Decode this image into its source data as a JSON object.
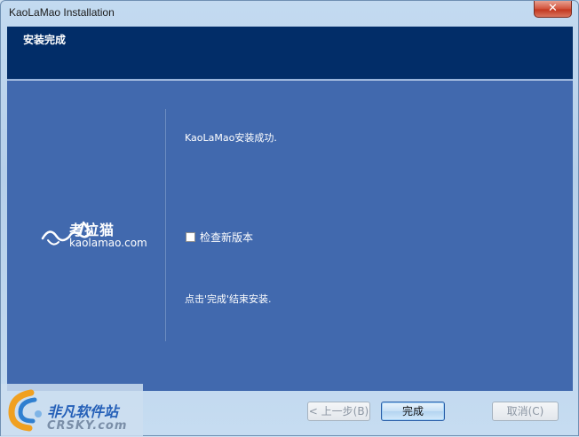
{
  "window": {
    "title": "KaoLaMao Installation",
    "close_label": "✕"
  },
  "header": {
    "title": "安装完成"
  },
  "logo": {
    "name_cn": "考拉猫",
    "domain": "kaolamao.com"
  },
  "content": {
    "success_message": "KaoLaMao安装成功.",
    "checkbox_label": "检查新版本",
    "checkbox_checked": false,
    "finish_hint": "点击'完成'结束安装."
  },
  "buttons": {
    "back": "< 上一步(B)",
    "finish": "完成",
    "cancel": "取消(C)"
  },
  "watermark": {
    "name_cn": "非凡软件站",
    "name_en": "CRSKY.com"
  },
  "colors": {
    "header_bg": "#022d68",
    "content_bg": "#4169ae",
    "close_button": "#c2371f"
  }
}
